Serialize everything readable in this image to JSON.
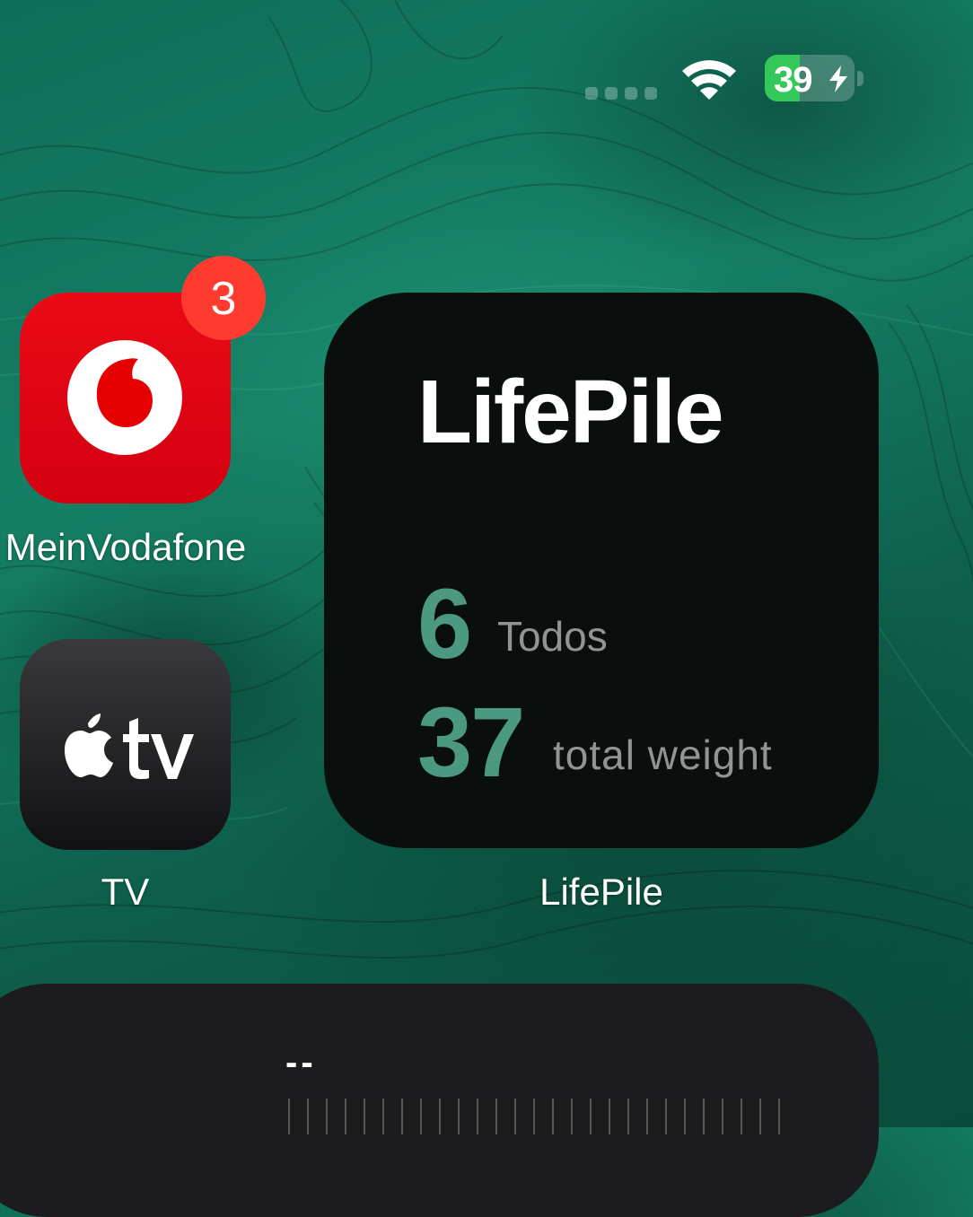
{
  "status_bar": {
    "battery_percent": "39",
    "battery_level": 0.39,
    "charging": true,
    "signal_dots": 4,
    "wifi_icon": "wifi-icon",
    "charging_icon": "bolt-icon"
  },
  "apps": [
    {
      "label": "MeinVodafone",
      "badge": "3",
      "icon": "vodafone-logo-icon",
      "color": "#e60000"
    },
    {
      "label": "TV",
      "icon": "apple-tv-icon"
    }
  ],
  "widget": {
    "title": "LifePile",
    "stats": [
      {
        "value": "6",
        "label": "Todos"
      },
      {
        "value": "37",
        "label": "total weight"
      }
    ],
    "app_label": "LifePile",
    "accent_color": "#4b9981"
  },
  "bottom_widget": {
    "value": "--"
  }
}
